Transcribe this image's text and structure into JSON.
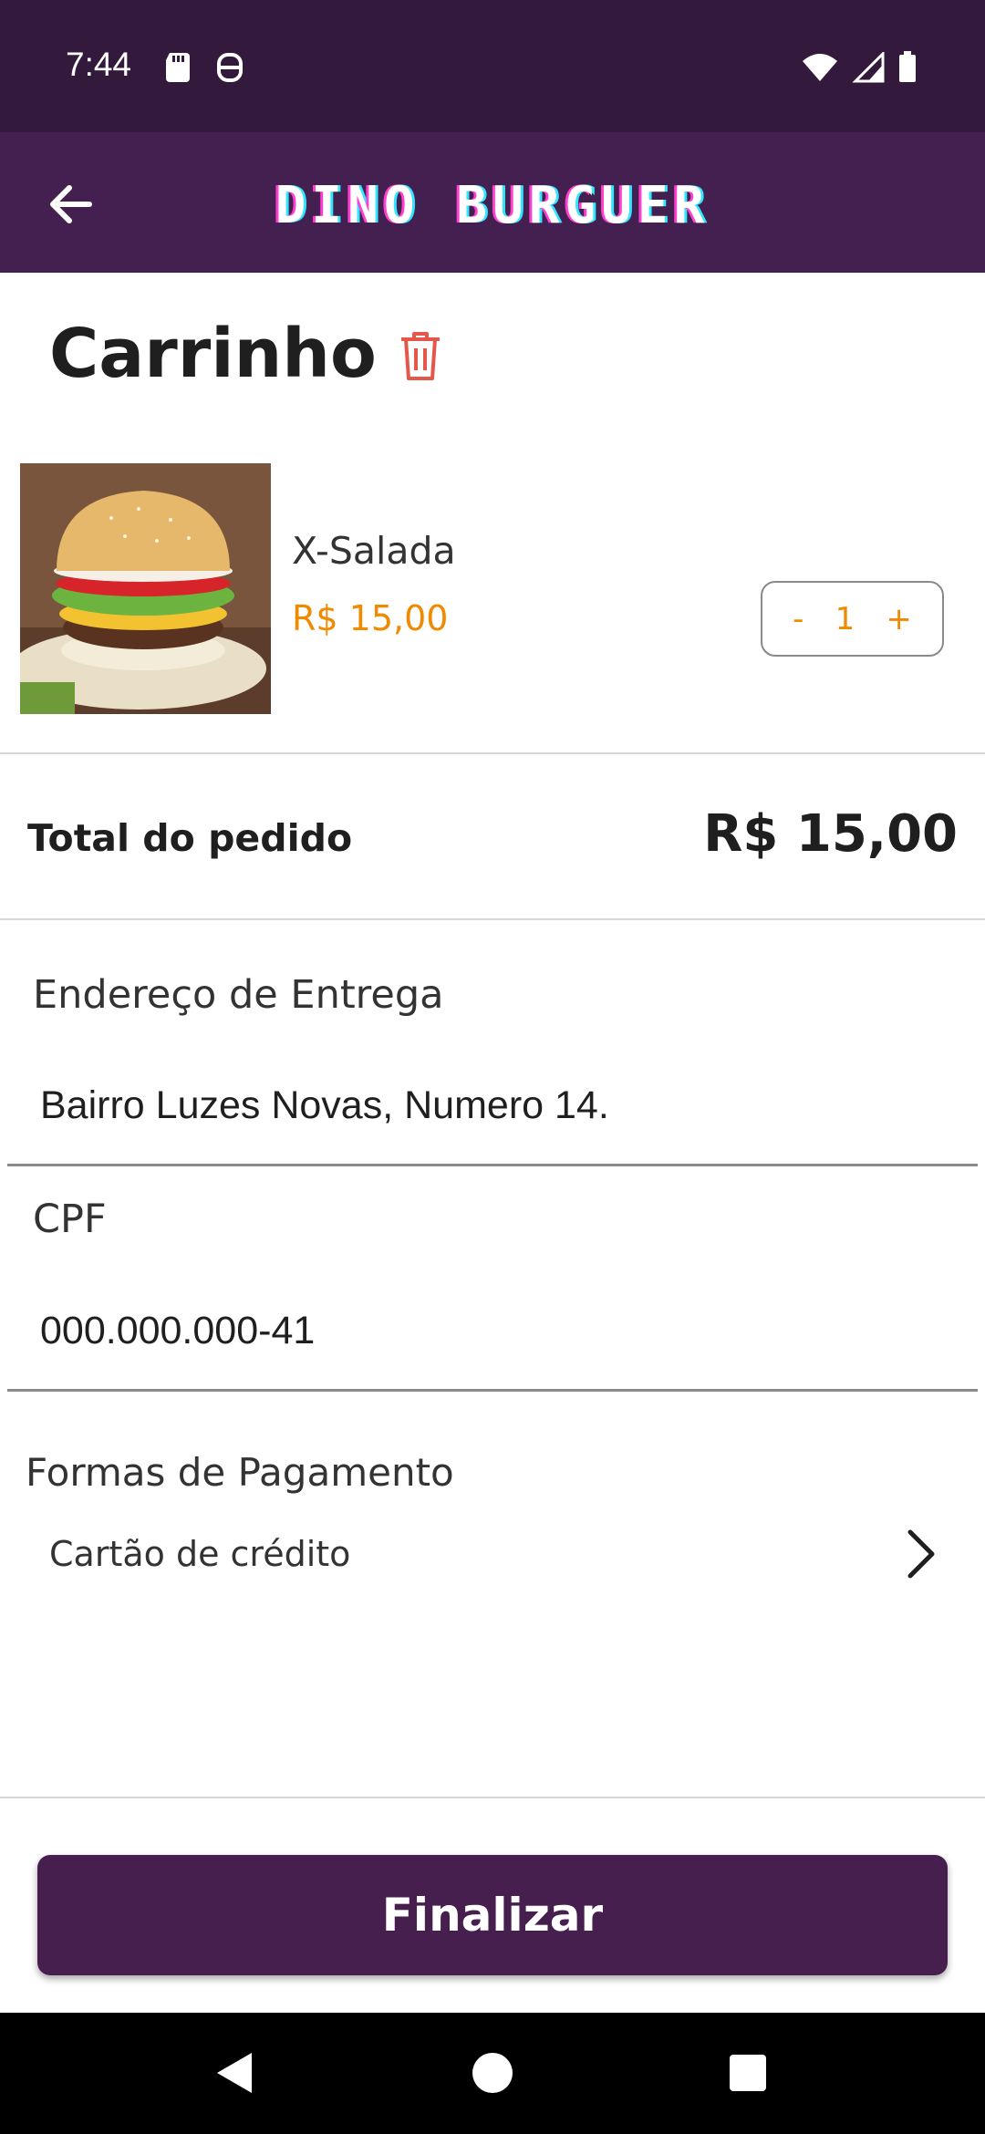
{
  "status_bar": {
    "time": "7:44"
  },
  "app_bar": {
    "title": "DINO BURGUER"
  },
  "cart": {
    "title": "Carrinho",
    "items": [
      {
        "name": "X-Salada",
        "price": "R$ 15,00",
        "quantity": "1",
        "decrement_label": "-",
        "increment_label": "+"
      }
    ]
  },
  "order_total": {
    "label": "Total do pedido",
    "value": "R$ 15,00"
  },
  "delivery_address": {
    "label": "Endereço de Entrega",
    "value": "Bairro Luzes Novas, Numero 14."
  },
  "cpf": {
    "label": "CPF",
    "value": "000.000.000-41"
  },
  "payment": {
    "title": "Formas de Pagamento",
    "selected": "Cartão de crédito"
  },
  "finalize_button": {
    "label": "Finalizar"
  },
  "colors": {
    "status_bar_bg": "#33193b",
    "app_bar_bg": "#442050",
    "accent_orange": "#f08a00",
    "primary_button": "#461f4f",
    "trash_icon": "#e4574b"
  },
  "icons": {
    "back": "arrow-left-icon",
    "trash": "trash-icon",
    "chevron": "chevron-right-icon",
    "nav_back": "triangle-back-icon",
    "nav_home": "circle-home-icon",
    "nav_recents": "square-recents-icon"
  }
}
